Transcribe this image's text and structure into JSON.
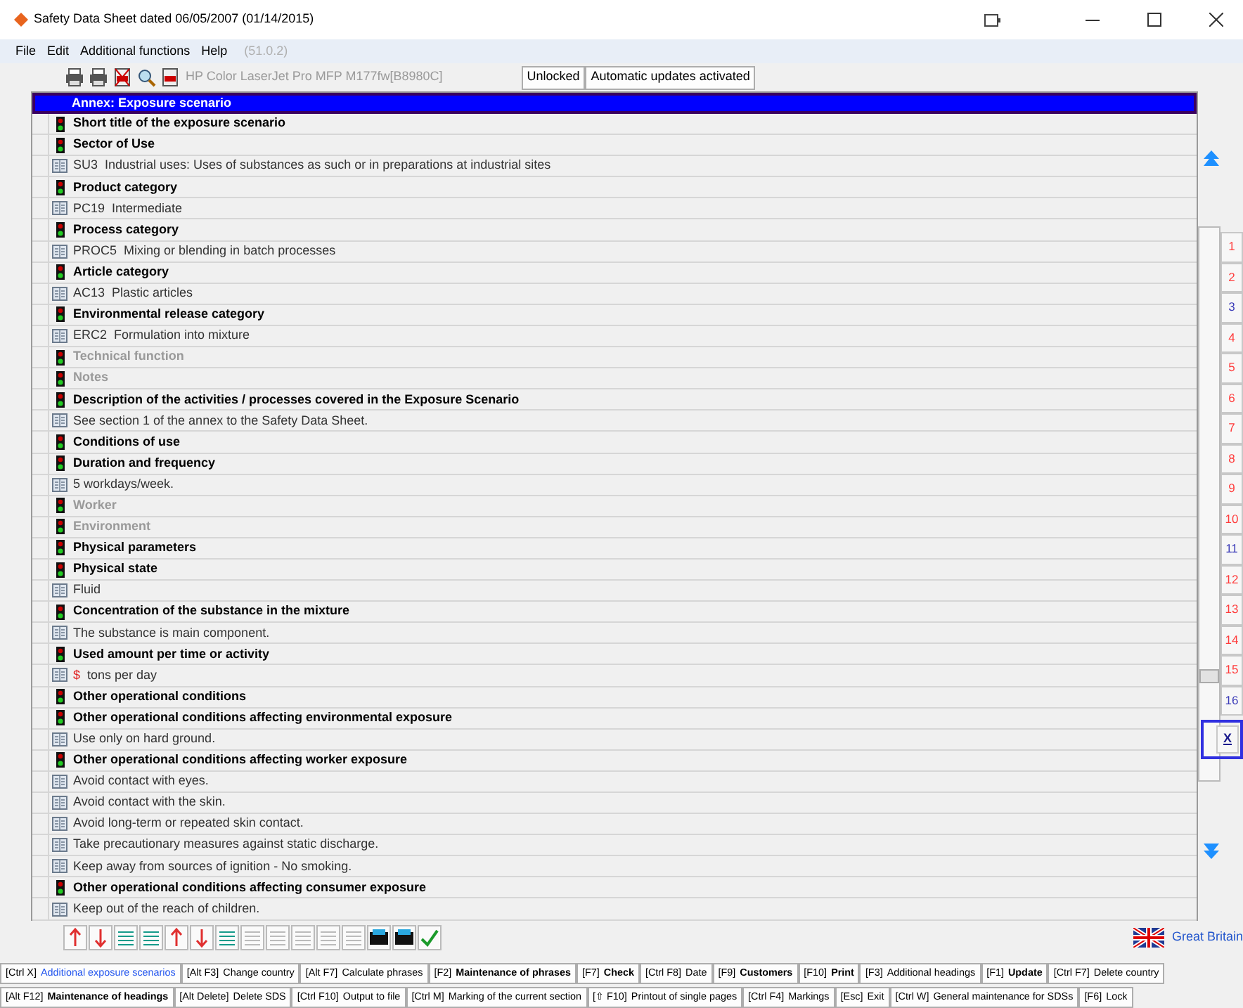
{
  "window": {
    "title": "Safety Data Sheet dated 06/05/2007 (01/14/2015)"
  },
  "menu": [
    "File",
    "Edit",
    "Additional functions",
    "Help"
  ],
  "version": "(51.0.2)",
  "toolbar": {
    "printer": "HP Color LaserJet Pro MFP M177fw[B8980C]",
    "buttons": [
      "Unlocked",
      "Automatic updates activated"
    ]
  },
  "banner": "Annex: Exposure scenario",
  "rows": [
    {
      "kind": "heading",
      "text": "Short title of the exposure scenario",
      "disabled": false
    },
    {
      "kind": "heading",
      "text": "Sector of Use",
      "disabled": false
    },
    {
      "kind": "phrase",
      "code": "SU3",
      "text": "Industrial uses: Uses of substances as such or in preparations at industrial sites"
    },
    {
      "kind": "heading",
      "text": "Product category",
      "disabled": false
    },
    {
      "kind": "phrase",
      "code": "PC19",
      "text": "Intermediate"
    },
    {
      "kind": "heading",
      "text": "Process category",
      "disabled": false
    },
    {
      "kind": "phrase",
      "code": "PROC5",
      "text": "Mixing or blending in batch processes"
    },
    {
      "kind": "heading",
      "text": "Article category",
      "disabled": false
    },
    {
      "kind": "phrase",
      "code": "AC13",
      "text": "Plastic articles"
    },
    {
      "kind": "heading",
      "text": "Environmental release category",
      "disabled": false
    },
    {
      "kind": "phrase",
      "code": "ERC2",
      "text": "Formulation into mixture"
    },
    {
      "kind": "heading",
      "text": "Technical function",
      "disabled": true
    },
    {
      "kind": "heading",
      "text": "Notes",
      "disabled": true
    },
    {
      "kind": "heading",
      "text": "Description of the activities / processes covered in the Exposure Scenario",
      "disabled": false
    },
    {
      "kind": "phrase",
      "text": "See section 1 of the annex to the Safety Data Sheet."
    },
    {
      "kind": "heading",
      "text": "Conditions of use",
      "disabled": false
    },
    {
      "kind": "heading",
      "text": "Duration and frequency",
      "disabled": false
    },
    {
      "kind": "phrase",
      "text": "5 workdays/week."
    },
    {
      "kind": "heading",
      "text": "Worker",
      "disabled": true
    },
    {
      "kind": "heading",
      "text": "Environment",
      "disabled": true
    },
    {
      "kind": "heading",
      "text": "Physical parameters",
      "disabled": false
    },
    {
      "kind": "heading",
      "text": "Physical state",
      "disabled": false
    },
    {
      "kind": "phrase",
      "text": "Fluid"
    },
    {
      "kind": "heading",
      "text": "Concentration of the substance in the mixture",
      "disabled": false
    },
    {
      "kind": "phrase",
      "text": "The substance is main component."
    },
    {
      "kind": "heading",
      "text": "Used amount per time or activity",
      "disabled": false
    },
    {
      "kind": "variable",
      "code": "$",
      "text": "tons per day"
    },
    {
      "kind": "heading",
      "text": "Other operational conditions",
      "disabled": false
    },
    {
      "kind": "heading",
      "text": "Other operational conditions affecting environmental exposure",
      "disabled": false
    },
    {
      "kind": "phrase",
      "text": "Use only on hard ground."
    },
    {
      "kind": "heading",
      "text": "Other operational conditions affecting worker exposure",
      "disabled": false
    },
    {
      "kind": "phrase",
      "text": "Avoid contact with eyes."
    },
    {
      "kind": "phrase",
      "text": "Avoid contact with the skin."
    },
    {
      "kind": "phrase",
      "text": "Avoid long-term or repeated skin contact."
    },
    {
      "kind": "phrase",
      "text": "Take precautionary measures against static discharge."
    },
    {
      "kind": "phrase",
      "text": "Keep away from sources of ignition - No smoking."
    },
    {
      "kind": "heading",
      "text": "Other operational conditions affecting consumer exposure",
      "disabled": false
    },
    {
      "kind": "phrase",
      "text": "Keep out of the reach of children."
    }
  ],
  "side_tabs": [
    {
      "label": "1",
      "color": "#ff3b3b"
    },
    {
      "label": "2",
      "color": "#ff3b3b"
    },
    {
      "label": "3",
      "color": "#3b3bb8"
    },
    {
      "label": "4",
      "color": "#ff3b3b"
    },
    {
      "label": "5",
      "color": "#ff3b3b"
    },
    {
      "label": "6",
      "color": "#ff3b3b"
    },
    {
      "label": "7",
      "color": "#ff3b3b"
    },
    {
      "label": "8",
      "color": "#ff3b3b"
    },
    {
      "label": "9",
      "color": "#ff3b3b"
    },
    {
      "label": "10",
      "color": "#ff3b3b"
    },
    {
      "label": "11",
      "color": "#3b3bb8"
    },
    {
      "label": "12",
      "color": "#ff3b3b"
    },
    {
      "label": "13",
      "color": "#ff3b3b"
    },
    {
      "label": "14",
      "color": "#ff3b3b"
    },
    {
      "label": "15",
      "color": "#ff3b3b"
    },
    {
      "label": "16",
      "color": "#3b3bb8"
    }
  ],
  "close_tab": "X",
  "country": "Great Britain",
  "function_keys": [
    [
      {
        "key": "[Ctrl X]",
        "label": "Additional exposure scenarios",
        "bold": false,
        "highlighted": true
      },
      {
        "key": "[Alt F3]",
        "label": "Change country",
        "bold": false,
        "highlighted": false
      },
      {
        "key": "[Alt F7]",
        "label": "Calculate phrases",
        "bold": false,
        "highlighted": false
      },
      {
        "key": "[F2]",
        "label": "Maintenance of phrases",
        "bold": true,
        "highlighted": false
      },
      {
        "key": "[F7]",
        "label": "Check",
        "bold": true,
        "highlighted": false
      },
      {
        "key": "[Ctrl F8]",
        "label": "Date",
        "bold": false,
        "highlighted": false
      },
      {
        "key": "[F9]",
        "label": "Customers",
        "bold": true,
        "highlighted": false
      },
      {
        "key": "[F10]",
        "label": "Print",
        "bold": true,
        "highlighted": false
      },
      {
        "key": "[F3]",
        "label": "Additional headings",
        "bold": false,
        "highlighted": false
      },
      {
        "key": "[F1]",
        "label": "Update",
        "bold": true,
        "highlighted": false
      },
      {
        "key": "[Ctrl F7]",
        "label": "Delete country",
        "bold": false,
        "highlighted": false
      }
    ],
    [
      {
        "key": "[Alt F12]",
        "label": "Maintenance of headings",
        "bold": true,
        "highlighted": false
      },
      {
        "key": "[Alt Delete]",
        "label": "Delete SDS",
        "bold": false,
        "highlighted": false
      },
      {
        "key": "[Ctrl F10]",
        "label": "Output to file",
        "bold": false,
        "highlighted": false
      },
      {
        "key": "[Ctrl M]",
        "label": "Marking of the current section",
        "bold": false,
        "highlighted": false
      },
      {
        "key": "[⇧ F10]",
        "label": "Printout of single pages",
        "bold": false,
        "highlighted": false
      },
      {
        "key": "[Ctrl F4]",
        "label": "Markings",
        "bold": false,
        "highlighted": false
      },
      {
        "key": "[Esc]",
        "label": "Exit",
        "bold": false,
        "highlighted": false
      },
      {
        "key": "[Ctrl W]",
        "label": "General maintenance for SDSs",
        "bold": false,
        "highlighted": false
      },
      {
        "key": "[F6]",
        "label": "Lock",
        "bold": false,
        "highlighted": false
      }
    ]
  ]
}
